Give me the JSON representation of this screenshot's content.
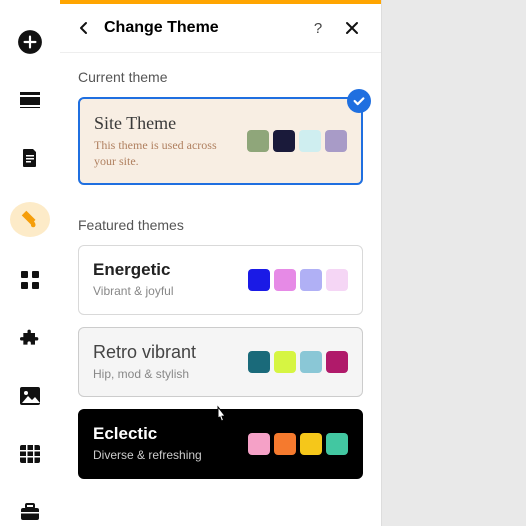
{
  "header": {
    "title": "Change Theme"
  },
  "sections": {
    "current_label": "Current theme",
    "featured_label": "Featured themes"
  },
  "themes": {
    "current": {
      "name": "Site Theme",
      "desc": "This theme is used across your site.",
      "colors": [
        "#8fa67a",
        "#1a1a3a",
        "#cfeef0",
        "#a89bc7"
      ]
    },
    "featured": [
      {
        "id": "energetic",
        "name": "Energetic",
        "desc": "Vibrant & joyful",
        "colors": [
          "#1a1ae6",
          "#e68ae6",
          "#b0b0f5",
          "#f5d6f5"
        ]
      },
      {
        "id": "retro",
        "name": "Retro vibrant",
        "desc": "Hip, mod & stylish",
        "colors": [
          "#1a6a7a",
          "#d6f542",
          "#8ac7d6",
          "#b01a6a"
        ]
      },
      {
        "id": "eclectic",
        "name": "Eclectic",
        "desc": "Diverse & refreshing",
        "colors": [
          "#f5a1c7",
          "#f57a2e",
          "#f5c71a",
          "#42c7a1"
        ]
      }
    ]
  }
}
